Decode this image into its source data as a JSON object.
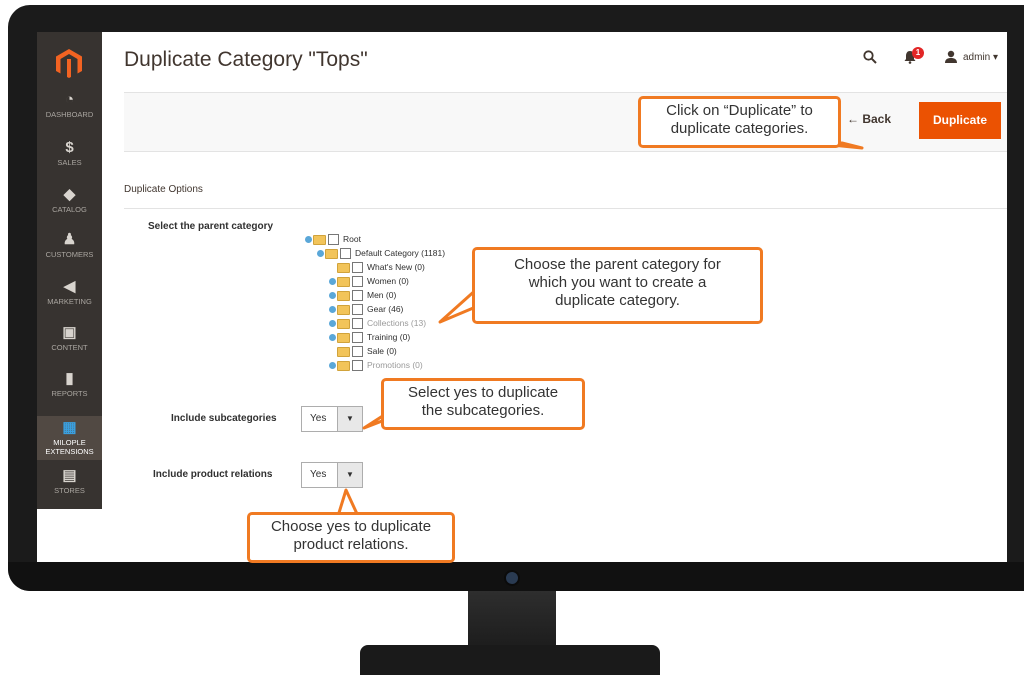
{
  "header": {
    "title": "Duplicate Category \"Tops\"",
    "admin_label": "admin ▾",
    "notification_count": "1"
  },
  "sidebar": {
    "items": [
      {
        "label": "DASHBOARD",
        "icon": "dashboard-icon",
        "glyph": "◔"
      },
      {
        "label": "SALES",
        "icon": "dollar-icon",
        "glyph": "$"
      },
      {
        "label": "CATALOG",
        "icon": "cube-icon",
        "glyph": "◆"
      },
      {
        "label": "CUSTOMERS",
        "icon": "person-icon",
        "glyph": "♟"
      },
      {
        "label": "MARKETING",
        "icon": "megaphone-icon",
        "glyph": "◀"
      },
      {
        "label": "CONTENT",
        "icon": "layout-icon",
        "glyph": "▣"
      },
      {
        "label": "REPORTS",
        "icon": "bar-chart-icon",
        "glyph": "▮"
      },
      {
        "label": "MILOPLE",
        "label2": "EXTENSIONS",
        "icon": "grid-icon",
        "glyph": "▦"
      },
      {
        "label": "STORES",
        "icon": "store-icon",
        "glyph": "▤"
      }
    ]
  },
  "actions": {
    "back_label": "← Back",
    "duplicate_label": "Duplicate"
  },
  "section": {
    "title": "Duplicate Options"
  },
  "form": {
    "parent_label": "Select the parent category",
    "subcategories_label": "Include subcategories",
    "subcategories_value": "Yes",
    "relations_label": "Include product relations",
    "relations_value": "Yes"
  },
  "tree": {
    "root": "Root",
    "default": "Default Category (1181)",
    "whats_new": "What's New (0)",
    "women": "Women (0)",
    "men": "Men (0)",
    "gear": "Gear (46)",
    "collections": "Collections (13)",
    "training": "Training (0)",
    "sale": "Sale (0)",
    "promotions": "Promotions (0)"
  },
  "callouts": {
    "duplicate_line1": "Click on “Duplicate” to",
    "duplicate_line2": "duplicate categories.",
    "parent_line1": "Choose the parent category for",
    "parent_line2": "which you want to create a",
    "parent_line3": "duplicate category.",
    "sub_line1": "Select yes to duplicate",
    "sub_line2": "the subcategories.",
    "rel_line1": "Choose yes to duplicate",
    "rel_line2": "product relations."
  },
  "colors": {
    "accent": "#eb5202",
    "callout_border": "#f07a22",
    "sidebar_bg": "#373330"
  }
}
